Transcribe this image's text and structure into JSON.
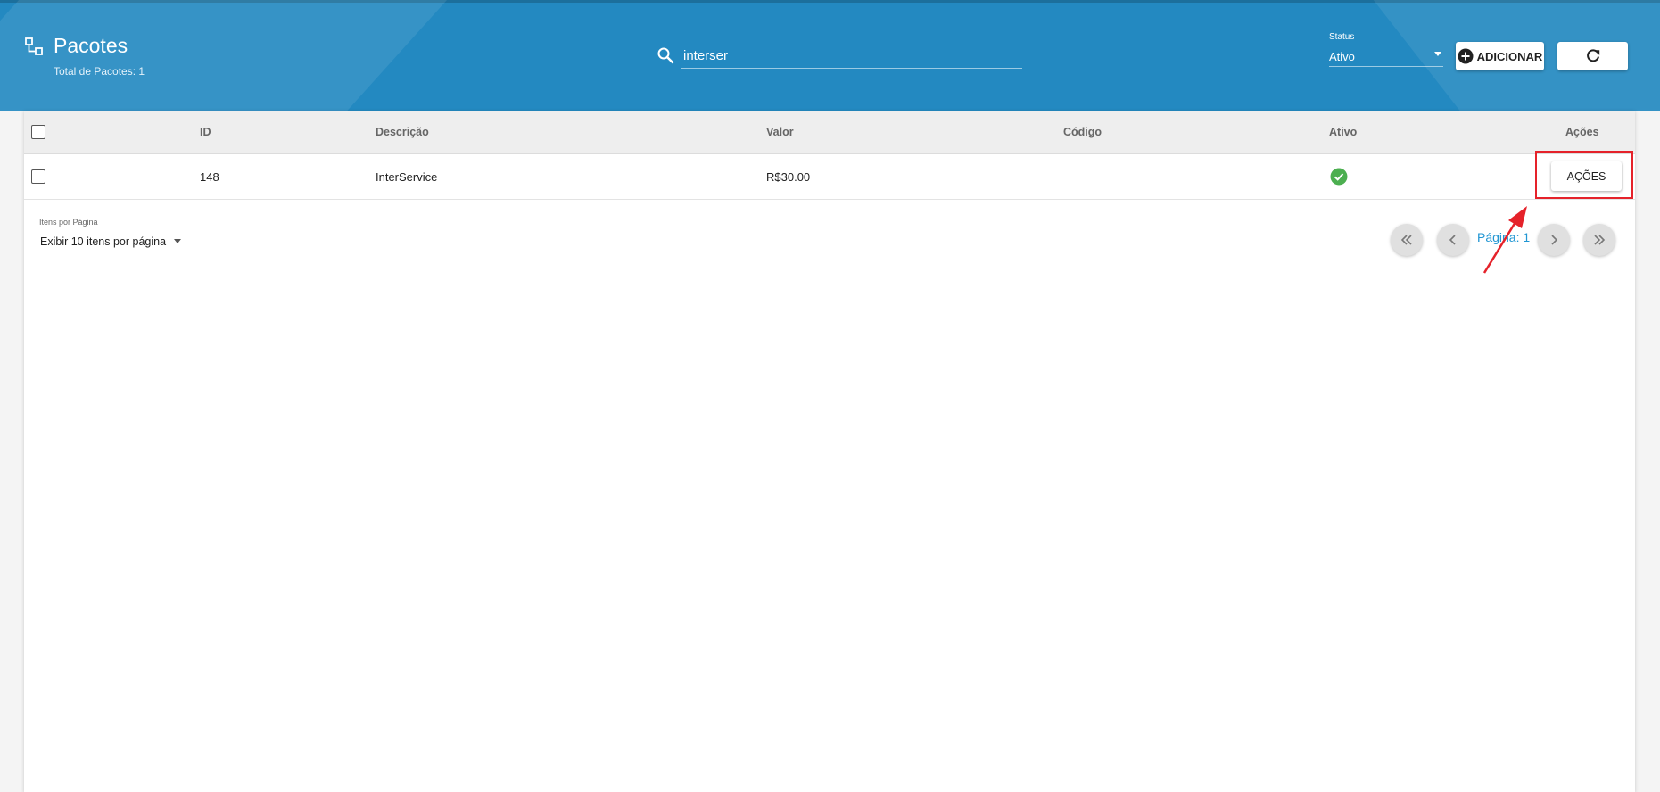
{
  "header": {
    "title": "Pacotes",
    "subtitle": "Total de Pacotes: 1",
    "search_value": "interser",
    "status_label": "Status",
    "status_value": "Ativo",
    "add_label": "ADICIONAR"
  },
  "table": {
    "columns": [
      "ID",
      "Descrição",
      "Valor",
      "Código",
      "Ativo",
      "Ações"
    ],
    "rows": [
      {
        "id": "148",
        "descricao": "InterService",
        "valor": "R$30.00",
        "codigo": "",
        "ativo": true,
        "acoes_label": "AÇÕES"
      }
    ]
  },
  "pagination": {
    "per_page_label": "Itens por Página",
    "per_page_value": "Exibir 10 itens por página",
    "page_text": "Página: 1"
  },
  "colors": {
    "header_bg": "#2389c1",
    "accent": "#2196d3",
    "active_check": "#4caf50",
    "highlight": "#e5222a"
  },
  "icons": [
    "packages-icon",
    "search-icon",
    "add-circle-icon",
    "refresh-icon",
    "check-circle-icon",
    "first-page-icon",
    "prev-page-icon",
    "next-page-icon",
    "last-page-icon"
  ]
}
